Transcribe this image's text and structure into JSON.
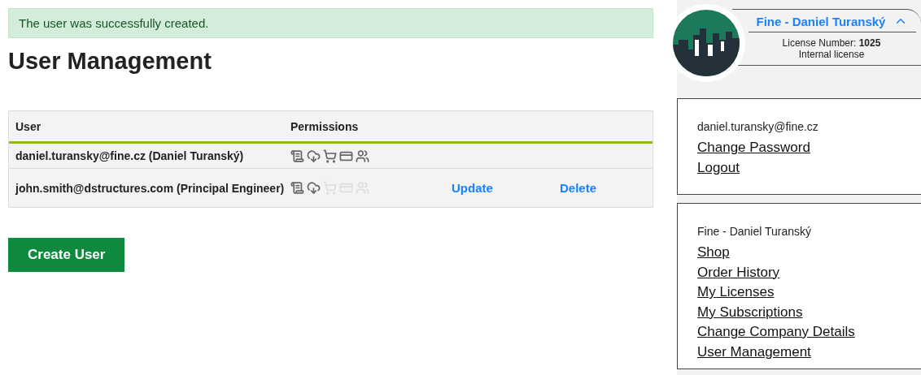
{
  "alert": {
    "text": "The user was successfully created."
  },
  "title": "User Management",
  "table": {
    "columns": [
      "User",
      "Permissions"
    ],
    "rows": [
      {
        "user": "daniel.turansky@fine.cz (Daniel Turanský)",
        "permissions": [
          {
            "kind": "license",
            "enabled": true
          },
          {
            "kind": "download",
            "enabled": true
          },
          {
            "kind": "cart",
            "enabled": true
          },
          {
            "kind": "card",
            "enabled": true
          },
          {
            "kind": "group",
            "enabled": true
          }
        ],
        "actions": []
      },
      {
        "user": "john.smith@dstructures.com (Principal Engineer)",
        "permissions": [
          {
            "kind": "license",
            "enabled": true
          },
          {
            "kind": "download",
            "enabled": true
          },
          {
            "kind": "cart",
            "enabled": false
          },
          {
            "kind": "card",
            "enabled": false
          },
          {
            "kind": "group",
            "enabled": false
          }
        ],
        "actions": [
          "Update",
          "Delete"
        ]
      }
    ]
  },
  "create_button": "Create User",
  "profile": {
    "name": "Fine - Daniel Turanský",
    "expanded": true,
    "license_label": "License Number:",
    "license_number": "1025",
    "license_type": "Internal license"
  },
  "account": {
    "email": "daniel.turansky@fine.cz",
    "links": [
      "Change Password",
      "Logout"
    ]
  },
  "company": {
    "name": "Fine - Daniel Turanský",
    "links": [
      "Shop",
      "Order History",
      "My Licenses",
      "My Subscriptions",
      "Change Company Details",
      "User Management"
    ]
  }
}
